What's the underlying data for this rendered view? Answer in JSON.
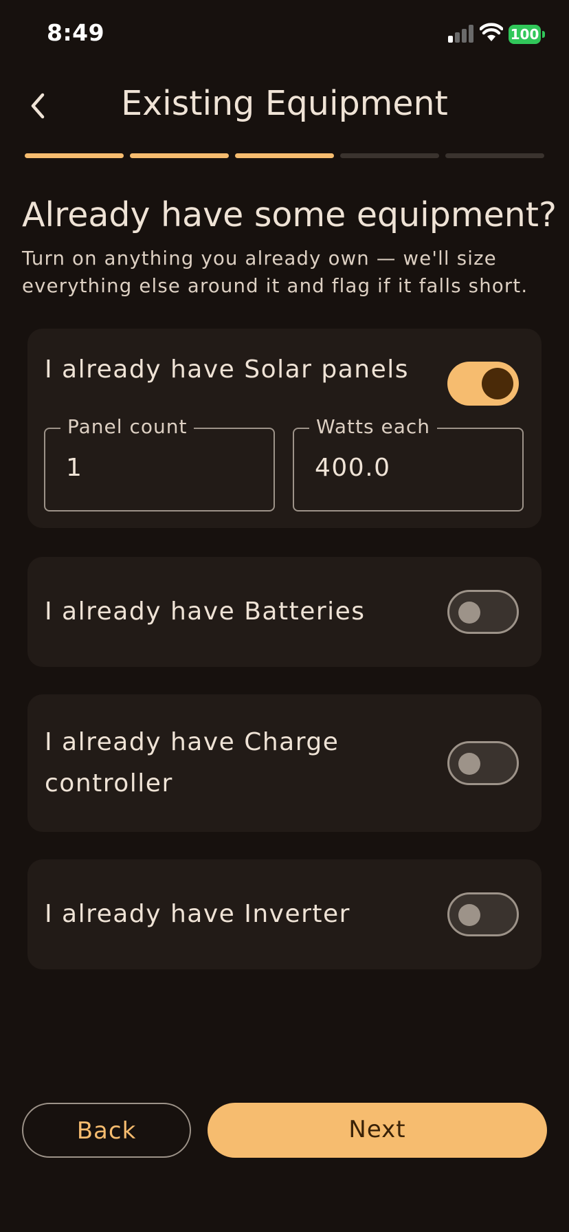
{
  "status_bar": {
    "time": "8:49",
    "battery": "100"
  },
  "header": {
    "title": "Existing Equipment",
    "back_icon": "chevron-left-icon"
  },
  "progress": {
    "total_steps": 5,
    "completed_steps": 3
  },
  "intro": {
    "heading": "Already have some equipment?",
    "subtitle": "Turn on anything you already own — we'll size everything else around it and flag if it falls short."
  },
  "equipment": {
    "solar": {
      "label": "I already have Solar panels",
      "enabled": true,
      "panel_count_label": "Panel count",
      "panel_count": "1",
      "watts_label": "Watts each",
      "watts": "400.0"
    },
    "batteries": {
      "label": "I already have Batteries",
      "enabled": false
    },
    "charge_controller": {
      "label": "I already have Charge controller",
      "enabled": false
    },
    "inverter": {
      "label": "I already have Inverter",
      "enabled": false
    }
  },
  "footer": {
    "back_label": "Back",
    "next_label": "Next"
  },
  "colors": {
    "accent": "#f6bc6f",
    "background": "#17110e",
    "card": "#221b17"
  }
}
